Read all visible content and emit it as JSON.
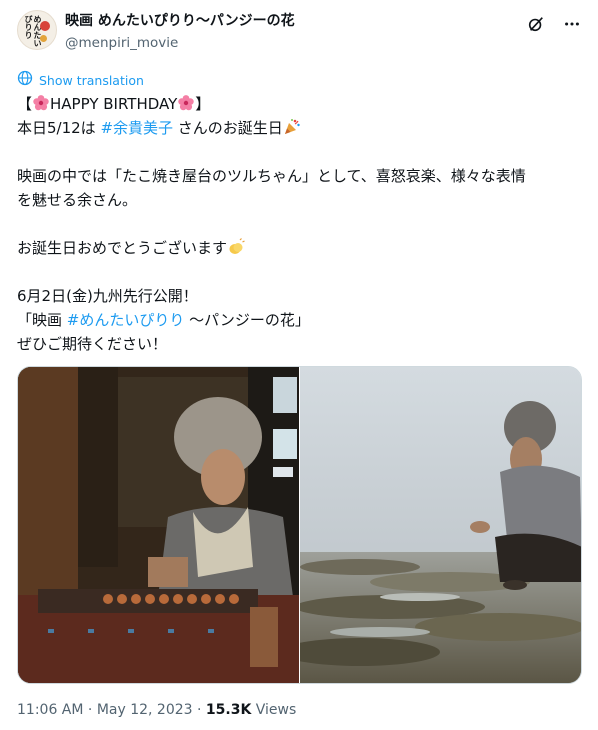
{
  "account": {
    "display_name": "映画 めんたいぴりり～パンジーの花",
    "handle": "@menpiri_movie",
    "avatar_text": "めんたいぴりり"
  },
  "header": {
    "icons": [
      "grok-icon",
      "more-icon"
    ]
  },
  "translate": {
    "label": "Show translation"
  },
  "tweet": {
    "l1_open": "【",
    "l1_text": "HAPPY BIRTHDAY",
    "l1_close": "】",
    "l2_pre": "本日5/12は ",
    "l2_tag": "#余貴美子",
    "l2_post": " さんのお誕生日",
    "l4": "映画の中では「たこ焼き屋台のツルちゃん」として、喜怒哀楽、様々な表情",
    "l5": "を魅せる余さん。",
    "l7": "お誕生日おめでとうございます",
    "l9": "6月2日(金)九州先行公開！",
    "l10_pre": "「映画 ",
    "l10_tag": "#めんたいぴりり",
    "l10_post": " ～パンジーの花」",
    "l11": "ぜひご期待ください！"
  },
  "media": {
    "left_alt": "たこ焼き屋台のツルちゃん",
    "right_alt": "海辺のツルちゃん"
  },
  "footer": {
    "time": "11:06 AM",
    "sep1": " · ",
    "date": "May 12, 2023",
    "sep2": " · ",
    "views_count": "15.3K",
    "views_label": " Views"
  },
  "colors": {
    "link": "#1d9bf0",
    "muted": "#536471",
    "text": "#0f1419"
  }
}
